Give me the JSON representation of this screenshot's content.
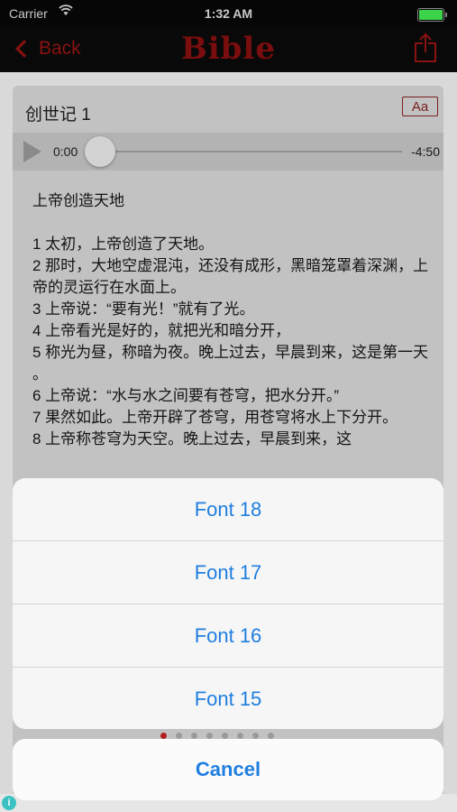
{
  "status_bar": {
    "carrier": "Carrier",
    "time": "1:32 AM",
    "battery_level": 1.0,
    "battery_color": "#3bd34a"
  },
  "nav": {
    "back_label": "Back",
    "title": "Bible",
    "share_icon": "share-icon",
    "accent_color": "#8a1212"
  },
  "chapter": {
    "title": "创世记 1",
    "font_button_label": "Aa"
  },
  "player": {
    "current_time": "0:00",
    "remaining_time": "-4:50",
    "progress": 0.0
  },
  "text": {
    "section_title": "上帝创造天地",
    "verses": [
      "1 太初，上帝创造了天地。",
      "2 那时，大地空虚混沌，还没有成形，黑暗笼罩着深渊，上帝的灵运行在水面上。",
      "3 上帝说：“要有光！”就有了光。",
      "4 上帝看光是好的，就把光和暗分开，",
      "5 称光为昼，称暗为夜。晚上过去，早晨到来，这是第一天 。",
      "6 上帝说：“水与水之间要有苍穹，把水分开。”",
      "7 果然如此。上帝开辟了苍穹，用苍穹将水上下分开。",
      "8 上帝称苍穹为天空。晚上过去，早晨到来，这"
    ]
  },
  "action_sheet": {
    "options": [
      "Font 18",
      "Font 17",
      "Font 16",
      "Font 15"
    ],
    "cancel_label": "Cancel",
    "option_color": "#1f7ee0"
  },
  "page_indicator": {
    "count": 8,
    "active_index": 0,
    "active_color": "#b21d1d"
  }
}
